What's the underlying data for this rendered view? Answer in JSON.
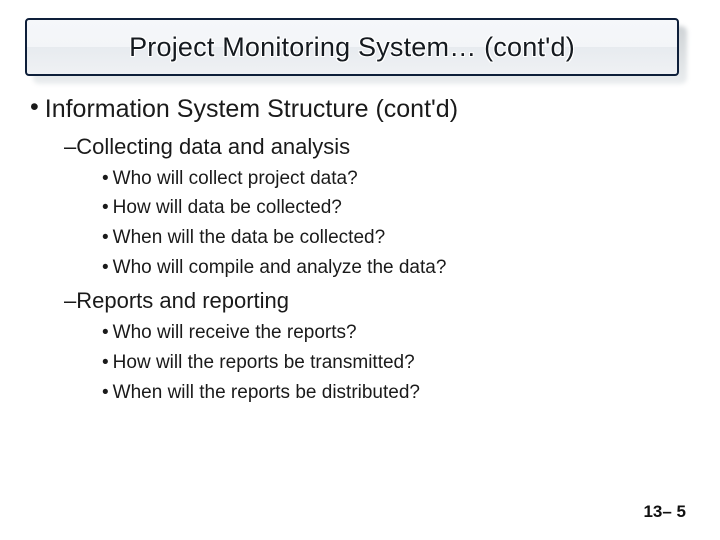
{
  "title": "Project Monitoring System… (cont'd)",
  "main_bullet": "Information System Structure (cont'd)",
  "sections": [
    {
      "heading": "–Collecting data and analysis",
      "items": [
        "Who will collect project data?",
        "How will data be collected?",
        "When will the data be collected?",
        "Who will compile and analyze the data?"
      ]
    },
    {
      "heading": "–Reports and reporting",
      "items": [
        "Who will receive the reports?",
        "How will the reports be transmitted?",
        "When will the reports be distributed?"
      ]
    }
  ],
  "footer": "13– 5",
  "bullet_glyph": "•"
}
